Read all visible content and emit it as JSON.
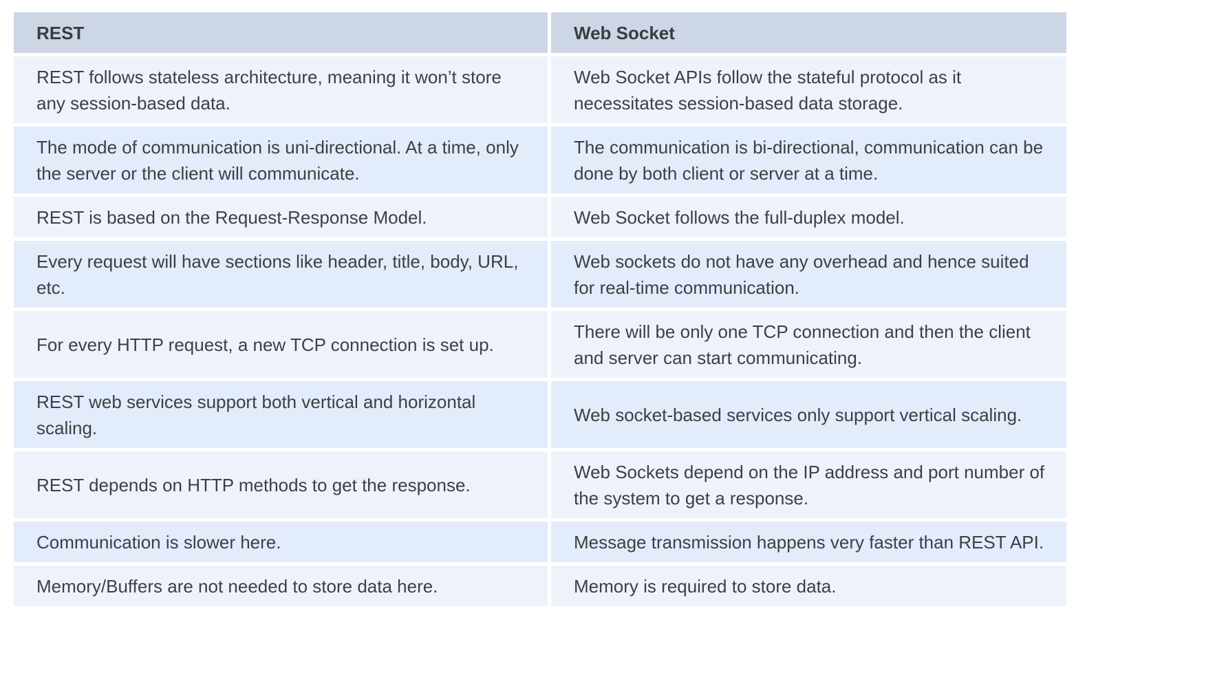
{
  "table": {
    "headers": [
      "REST",
      "Web Socket"
    ],
    "rows": [
      [
        "REST follows stateless architecture, meaning it won’t store any session-based data.",
        "Web Socket APIs follow the stateful protocol as it necessitates session-based data storage."
      ],
      [
        "The mode of communication is uni-directional. At a time, only the server or the client will communicate.",
        "The communication is bi-directional, communication can be done by both client or server at a time."
      ],
      [
        "REST is based on the Request-Response Model.",
        "Web Socket follows the full-duplex model."
      ],
      [
        "Every request will have sections like header, title, body, URL, etc.",
        "Web sockets do not have any overhead and hence suited for real-time communication."
      ],
      [
        "For every HTTP request, a new TCP connection is set up.",
        "There will be only one TCP connection and then the client and server can start communicating."
      ],
      [
        "REST web services support both vertical and horizontal scaling.",
        "Web socket-based services only support vertical scaling."
      ],
      [
        "REST depends on HTTP methods to get the response.",
        "Web Sockets depend on the IP address and port number of the system to get a response."
      ],
      [
        "Communication is slower here.",
        "Message transmission happens very faster than REST API."
      ],
      [
        "Memory/Buffers are not needed to store data here.",
        "Memory is required to store data."
      ]
    ]
  },
  "colors": {
    "header_bg": "#cdd6e4",
    "row_light": "#eef3fb",
    "row_blue": "#e2ecfa",
    "text": "#3d3f44"
  }
}
